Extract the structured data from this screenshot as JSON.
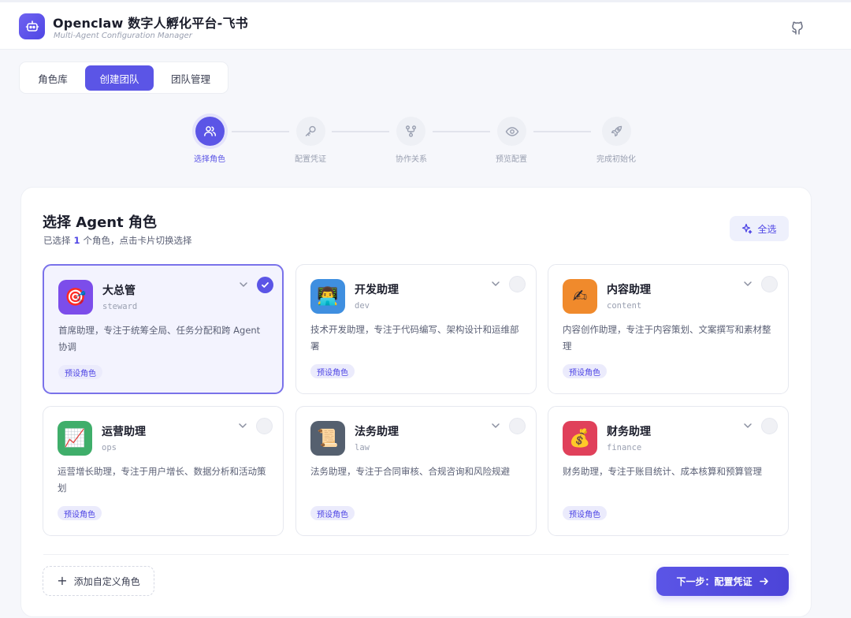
{
  "header": {
    "title": "Openclaw 数字人孵化平台-飞书",
    "subtitle": "Multi-Agent Configuration Manager",
    "github_icon": "github-icon"
  },
  "tabs": [
    {
      "label": "角色库",
      "active": false
    },
    {
      "label": "创建团队",
      "active": true
    },
    {
      "label": "团队管理",
      "active": false
    }
  ],
  "steps": [
    {
      "label": "选择角色",
      "icon": "users-icon",
      "active": true
    },
    {
      "label": "配置凭证",
      "icon": "key-icon",
      "active": false
    },
    {
      "label": "协作关系",
      "icon": "network-icon",
      "active": false
    },
    {
      "label": "预览配置",
      "icon": "eye-icon",
      "active": false
    },
    {
      "label": "完成初始化",
      "icon": "rocket-icon",
      "active": false
    }
  ],
  "panel": {
    "title": "选择 Agent 角色",
    "subtitle_prefix": "已选择",
    "selected_count": "1",
    "subtitle_suffix": "个角色，点击卡片切换选择",
    "select_all_label": "全选"
  },
  "roles": [
    {
      "name": "大总管",
      "code": "steward",
      "desc": "首席助理，专注于统筹全局、任务分配和跨 Agent 协调",
      "badge": "预设角色",
      "emoji": "🎯",
      "color": "#7c4dea",
      "selected": true
    },
    {
      "name": "开发助理",
      "code": "dev",
      "desc": "技术开发助理，专注于代码编写、架构设计和运维部署",
      "badge": "预设角色",
      "emoji": "👨‍💻",
      "color": "#3f8fe0",
      "selected": false
    },
    {
      "name": "内容助理",
      "code": "content",
      "desc": "内容创作助理，专注于内容策划、文案撰写和素材整理",
      "badge": "预设角色",
      "emoji": "✍",
      "color": "#f08a2c",
      "selected": false
    },
    {
      "name": "运营助理",
      "code": "ops",
      "desc": "运营增长助理，专注于用户增长、数据分析和活动策划",
      "badge": "预设角色",
      "emoji": "📈",
      "color": "#3fae6a",
      "selected": false
    },
    {
      "name": "法务助理",
      "code": "law",
      "desc": "法务助理，专注于合同审核、合规咨询和风险规避",
      "badge": "预设角色",
      "emoji": "📜",
      "color": "#55606f",
      "selected": false
    },
    {
      "name": "财务助理",
      "code": "finance",
      "desc": "财务助理，专注于账目统计、成本核算和预算管理",
      "badge": "预设角色",
      "emoji": "💰",
      "color": "#e0405a",
      "selected": false
    }
  ],
  "footer": {
    "add_custom_label": "添加自定义角色",
    "next_label": "下一步：配置凭证"
  },
  "colors": {
    "accent": "#5b55e6",
    "badge_bg": "#ebebfc"
  }
}
